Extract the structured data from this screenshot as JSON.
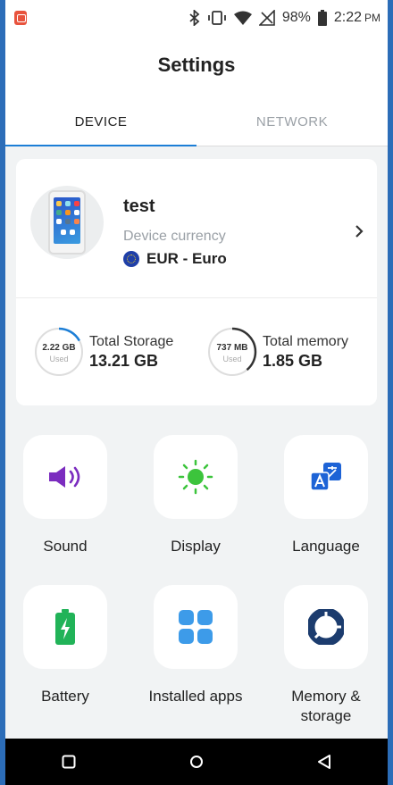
{
  "status_bar": {
    "battery_percent": "98%",
    "time": "2:22",
    "ampm": "PM",
    "icons": [
      "bluetooth-icon",
      "vibrate-icon",
      "wifi-icon",
      "no-signal-icon",
      "battery-icon"
    ]
  },
  "header": {
    "title": "Settings",
    "tabs": [
      {
        "label": "DEVICE",
        "active": true
      },
      {
        "label": "NETWORK",
        "active": false
      }
    ]
  },
  "device": {
    "name": "test",
    "currency_label": "Device currency",
    "currency_value": "EUR - Euro",
    "storage": {
      "used": "2.22 GB",
      "used_label": "Used",
      "title": "Total Storage",
      "total": "13.21 GB",
      "used_fraction": 0.17
    },
    "memory": {
      "used": "737 MB",
      "used_label": "Used",
      "title": "Total memory",
      "total": "1.85 GB",
      "used_fraction": 0.39
    }
  },
  "tiles": [
    {
      "label": "Sound",
      "icon": "speaker-icon",
      "color": "#7b2cbf"
    },
    {
      "label": "Display",
      "icon": "sun-icon",
      "color": "#3cc43c"
    },
    {
      "label": "Language",
      "icon": "translate-icon",
      "color": "#1d63d6"
    },
    {
      "label": "Battery",
      "icon": "battery-charging-icon",
      "color": "#21b358"
    },
    {
      "label": "Installed apps",
      "icon": "apps-grid-icon",
      "color": "#3d9be9"
    },
    {
      "label": "Memory & storage",
      "icon": "pie-chart-icon",
      "color": "#1c3c6e"
    }
  ],
  "colors": {
    "accent": "#1c7ed6",
    "ring_track": "#dddddd"
  }
}
